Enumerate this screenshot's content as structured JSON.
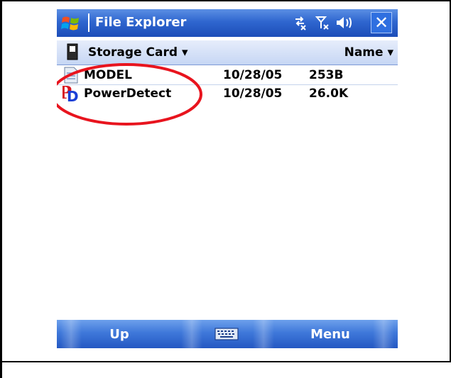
{
  "titlebar": {
    "title": "File Explorer",
    "status_icons": [
      "connectivity-icon",
      "signal-off-icon",
      "volume-icon"
    ],
    "close_label": "✕"
  },
  "header": {
    "location": "Storage Card ▾",
    "sort_label": "Name ▾"
  },
  "files": [
    {
      "name": "MODEL",
      "date": "10/28/05",
      "size": "253B",
      "icon": "document-icon"
    },
    {
      "name": "PowerDetect",
      "date": "10/28/05",
      "size": "26.0K",
      "icon": "powerdetect-app-icon"
    }
  ],
  "menubar": {
    "left_softkey": "Up",
    "right_softkey": "Menu",
    "center_icon": "keyboard-icon"
  },
  "colors": {
    "titlebar": "#2f66cf",
    "highlight": "#e8141e"
  }
}
